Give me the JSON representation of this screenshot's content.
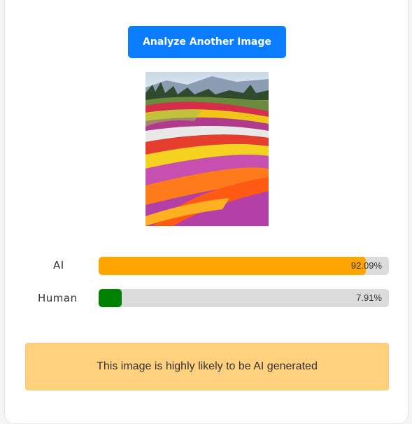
{
  "button": {
    "label": "Analyze Another Image"
  },
  "results": [
    {
      "label": "AI",
      "value": 92.09,
      "percent_text": "92.09%",
      "color": "#ffa500"
    },
    {
      "label": "Human",
      "value": 7.91,
      "percent_text": "7.91%",
      "color": "#008000"
    }
  ],
  "verdict": {
    "text": "This image is highly likely to be AI generated",
    "background": "#ffd07e"
  },
  "colors": {
    "accent": "#0a7cff",
    "track": "#dcdcdc"
  }
}
